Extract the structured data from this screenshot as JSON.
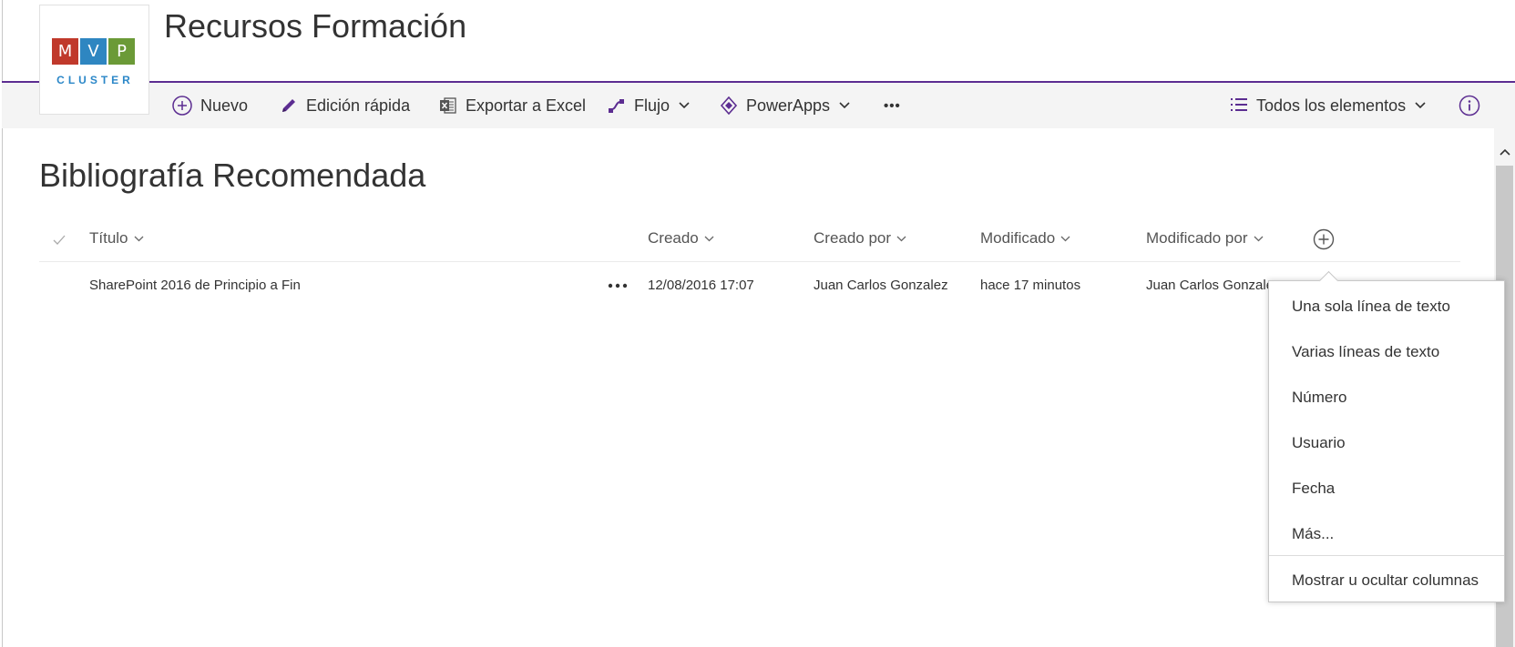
{
  "site": {
    "title": "Recursos Formación",
    "logo": {
      "letters": [
        "M",
        "V",
        "P"
      ],
      "tile_colors": [
        "#c0392b",
        "#2e86c1",
        "#6b9a37"
      ],
      "subtitle": "CLUSTER"
    }
  },
  "commandbar": {
    "new_label": "Nuevo",
    "quick_edit_label": "Edición rápida",
    "export_label": "Exportar a Excel",
    "flow_label": "Flujo",
    "powerapps_label": "PowerApps",
    "overflow_label": "•••",
    "view_label": "Todos los elementos"
  },
  "list": {
    "title": "Bibliografía Recomendada",
    "columns": [
      "Título",
      "Creado",
      "Creado por",
      "Modificado",
      "Modificado por"
    ],
    "rows": [
      {
        "title": "SharePoint 2016 de Principio a Fin",
        "created": "12/08/2016 17:07",
        "created_by": "Juan Carlos Gonzalez",
        "modified": "hace 17 minutos",
        "modified_by": "Juan Carlos Gonzalez"
      }
    ]
  },
  "add_column_menu": {
    "items": [
      "Una sola línea de texto",
      "Varias líneas de texto",
      "Número",
      "Usuario",
      "Fecha",
      "Más..."
    ],
    "footer": "Mostrar u ocultar columnas"
  },
  "colors": {
    "accent": "#5c2d91",
    "commandbar_bg": "#f4f4f4",
    "text": "#333333"
  }
}
